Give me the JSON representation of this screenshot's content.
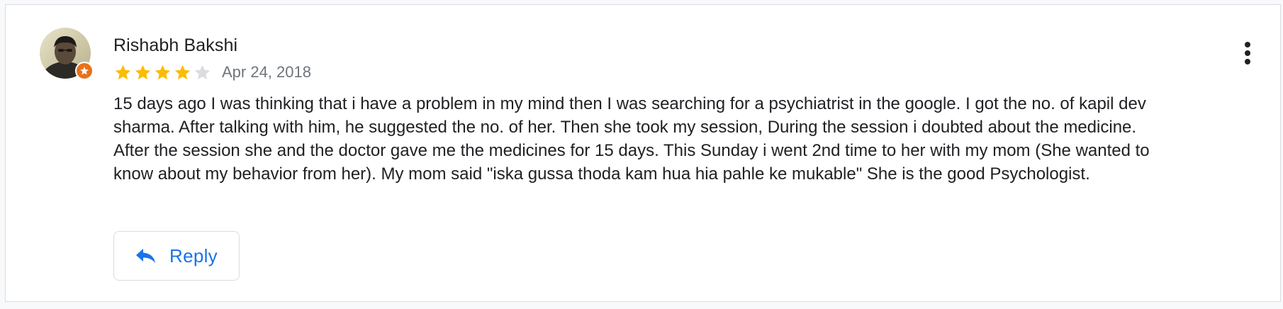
{
  "review": {
    "author": "Rishabh Bakshi",
    "rating": 4,
    "max_rating": 5,
    "date": "Apr 24, 2018",
    "text": "15 days ago I was thinking that i have a problem in my mind then I was searching for a psychiatrist in the google. I got the no. of kapil dev sharma. After talking with him, he suggested the no. of her. Then she took my session, During the session i doubted about the medicine. After the session she and the doctor gave me the medicines for 15 days. This Sunday i went 2nd time to her with my mom (She wanted to know about my behavior from her). My mom said \"iska gussa thoda kam hua hia pahle ke mukable\" She is the good Psychologist."
  },
  "actions": {
    "reply_label": "Reply",
    "reply_icon": "reply-arrow-icon",
    "menu_icon": "more-vert-icon"
  },
  "colors": {
    "star_filled": "#fbbc04",
    "star_empty": "#dadce0",
    "accent": "#1a73e8",
    "badge": "#e8711c",
    "text_primary": "#202124",
    "text_secondary": "#70757a"
  }
}
